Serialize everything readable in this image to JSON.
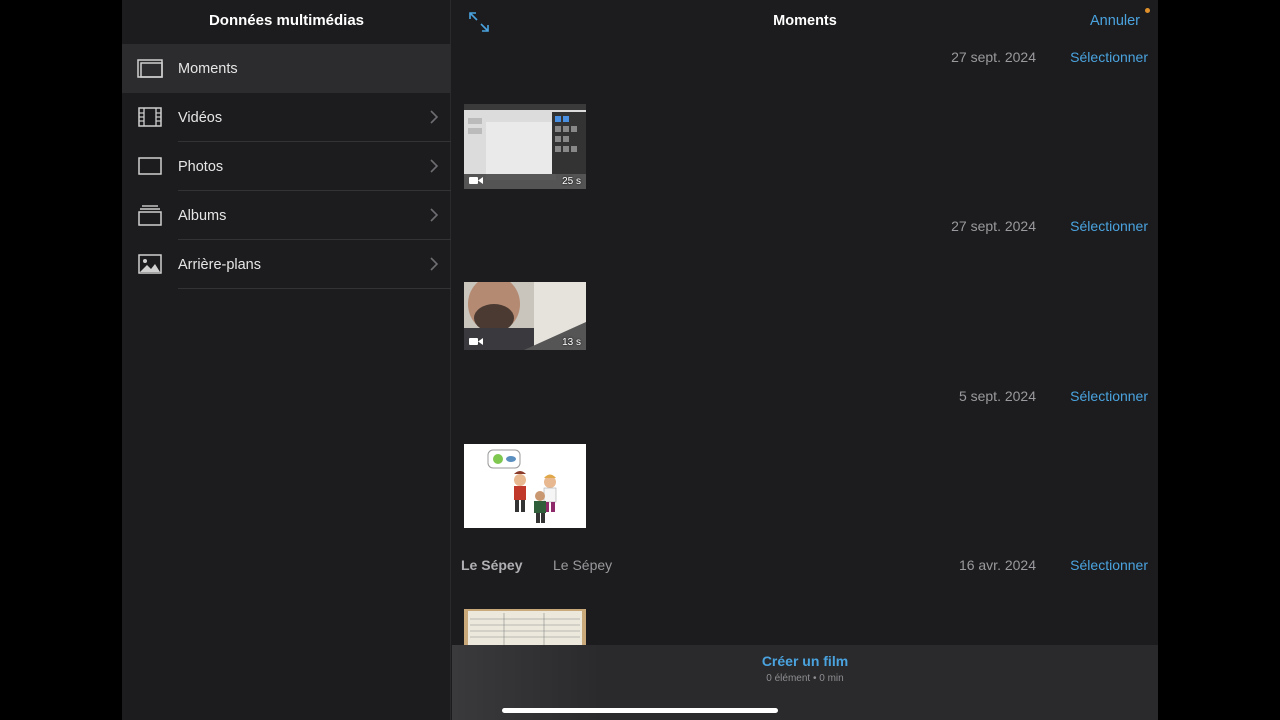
{
  "sidebar": {
    "title": "Données multimédias",
    "items": [
      {
        "label": "Moments",
        "icon": "moments-icon"
      },
      {
        "label": "Vidéos",
        "icon": "film-icon"
      },
      {
        "label": "Photos",
        "icon": "photo-frame-icon"
      },
      {
        "label": "Albums",
        "icon": "albums-icon"
      },
      {
        "label": "Arrière-plans",
        "icon": "landscape-icon"
      }
    ]
  },
  "main": {
    "title": "Moments",
    "cancel_label": "Annuler",
    "sections": [
      {
        "date": "27 sept. 2024",
        "select_label": "Sélectionner",
        "thumb_duration": "25 s"
      },
      {
        "date": "27 sept. 2024",
        "select_label": "Sélectionner",
        "thumb_duration": "13 s"
      },
      {
        "date": "5 sept. 2024",
        "select_label": "Sélectionner"
      },
      {
        "location": "Le Sépey",
        "sublocation": "Le Sépey",
        "date": "16 avr. 2024",
        "select_label": "Sélectionner"
      }
    ]
  },
  "bottom": {
    "create_label": "Créer un film",
    "info": "0 élément • 0 min"
  },
  "colors": {
    "accent": "#4aa3df",
    "background": "#1c1c1e",
    "notification_dot": "#e0902a"
  }
}
